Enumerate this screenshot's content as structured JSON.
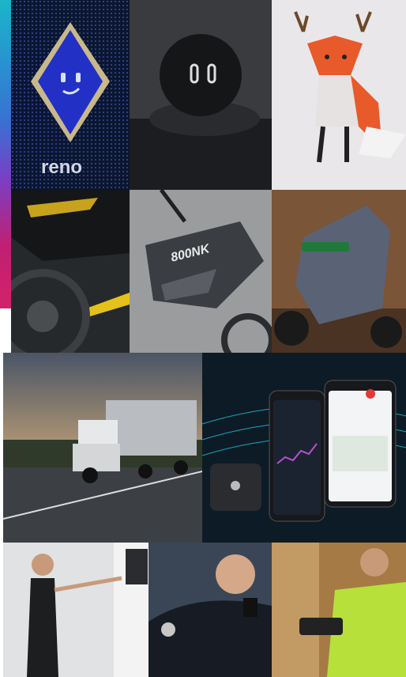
{
  "gallery": {
    "tiles": [
      {
        "id": "reno-robot",
        "caption": "reno"
      },
      {
        "id": "car-dashboard-robot"
      },
      {
        "id": "lowpoly-fox"
      },
      {
        "id": "motorcycle-closeup"
      },
      {
        "id": "nk-motorcycle",
        "caption": "800NK"
      },
      {
        "id": "electric-scooter"
      },
      {
        "id": "semi-truck"
      },
      {
        "id": "fleet-app"
      },
      {
        "id": "woman-kiosk"
      },
      {
        "id": "police-officer"
      },
      {
        "id": "warehouse-worker"
      }
    ]
  },
  "colors": {
    "accent_top": "#1ab6c9",
    "accent_bottom": "#d2236a",
    "reno_blue": "#2330c6",
    "app_dark": "#0d1b26",
    "fox_orange": "#e85a2a"
  }
}
